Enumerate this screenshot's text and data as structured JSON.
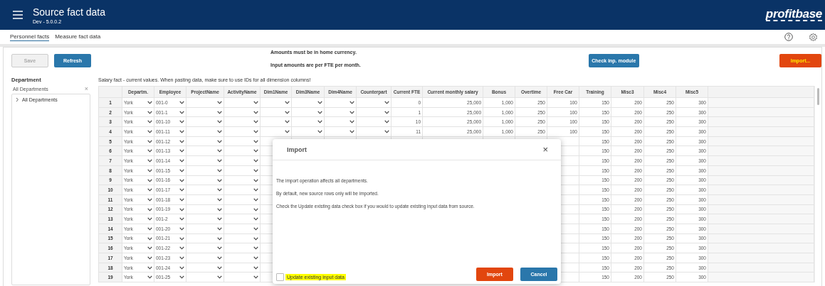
{
  "header": {
    "title": "Source fact data",
    "subtitle": "Dev - 5.0.0.2",
    "logo": "profitbase"
  },
  "tabs": [
    {
      "label": "Personnel facts",
      "selected": true
    },
    {
      "label": "Measure fact data",
      "selected": false
    }
  ],
  "toolbar": {
    "buttons": [
      {
        "label": "Save",
        "kind": "default",
        "disabled": true
      },
      {
        "label": "Refresh",
        "kind": "primary",
        "disabled": false
      }
    ],
    "notes": [
      "Amounts must be in home currency.",
      "Input amounts are per FTE per month."
    ],
    "right_buttons": [
      {
        "label": "Check inp. module",
        "kind": "primary",
        "disabled": false
      },
      {
        "label": "Import...",
        "kind": "accent",
        "disabled": false
      }
    ]
  },
  "sidebar": {
    "label": "Department",
    "filter": {
      "value": "All Departments",
      "clear": "×"
    },
    "tree": [
      {
        "label": "All Departments",
        "expanded": false
      }
    ]
  },
  "table": {
    "caption": "Salary fact - current values. When pasting data, make sure to use IDs for all dimension columns!",
    "columns": [
      {
        "label": "Departm.",
        "kind": "dropdown"
      },
      {
        "label": "Employee",
        "kind": "dropdown"
      },
      {
        "label": "ProjectName",
        "kind": "dropdown"
      },
      {
        "label": "ActivityName",
        "kind": "dropdown"
      },
      {
        "label": "Dim1Name",
        "kind": "dropdown"
      },
      {
        "label": "Dim3Name",
        "kind": "dropdown"
      },
      {
        "label": "Dim4Name",
        "kind": "dropdown"
      },
      {
        "label": "Counterpart",
        "kind": "dropdown"
      },
      {
        "label": "Current FTE",
        "kind": "number"
      },
      {
        "label": "Current monthly salary",
        "kind": "number"
      },
      {
        "label": "Bonus",
        "kind": "number"
      },
      {
        "label": "Overtime",
        "kind": "number"
      },
      {
        "label": "Free Car",
        "kind": "number"
      },
      {
        "label": "Training",
        "kind": "number"
      },
      {
        "label": "Misc3",
        "kind": "number"
      },
      {
        "label": "Misc4",
        "kind": "number"
      },
      {
        "label": "Misc5",
        "kind": "number"
      }
    ],
    "rows": [
      {
        "number": "1",
        "cells": [
          "York",
          "001-0",
          null,
          null,
          null,
          null,
          null,
          null,
          "0",
          "25,000",
          "1,000",
          "250",
          "100",
          "150",
          "200",
          "250",
          "300"
        ]
      },
      {
        "number": "2",
        "cells": [
          "York",
          "001-1",
          null,
          null,
          null,
          null,
          null,
          null,
          "1",
          "25,000",
          "1,000",
          "250",
          "100",
          "150",
          "200",
          "250",
          "300"
        ]
      },
      {
        "number": "3",
        "cells": [
          "York",
          "001-10",
          null,
          null,
          null,
          null,
          null,
          null,
          "10",
          "25,000",
          "1,000",
          "250",
          "100",
          "150",
          "200",
          "250",
          "300"
        ]
      },
      {
        "number": "4",
        "cells": [
          "York",
          "001-11",
          null,
          null,
          null,
          null,
          null,
          null,
          "11",
          "25,000",
          "1,000",
          "250",
          "100",
          "150",
          "200",
          "250",
          "300"
        ]
      },
      {
        "number": "5",
        "cells": [
          "York",
          "001-12",
          null,
          null,
          null,
          null,
          null,
          null,
          null,
          null,
          null,
          null,
          null,
          "150",
          "200",
          "250",
          "300"
        ]
      },
      {
        "number": "6",
        "cells": [
          "York",
          "001-13",
          null,
          null,
          null,
          null,
          null,
          null,
          null,
          null,
          null,
          null,
          null,
          "150",
          "200",
          "250",
          "300"
        ]
      },
      {
        "number": "7",
        "cells": [
          "York",
          "001-14",
          null,
          null,
          null,
          null,
          null,
          null,
          null,
          null,
          null,
          null,
          null,
          "150",
          "200",
          "250",
          "300"
        ]
      },
      {
        "number": "8",
        "cells": [
          "York",
          "001-15",
          null,
          null,
          null,
          null,
          null,
          null,
          null,
          null,
          null,
          null,
          null,
          "150",
          "200",
          "250",
          "300"
        ]
      },
      {
        "number": "9",
        "cells": [
          "York",
          "001-16",
          null,
          null,
          null,
          null,
          null,
          null,
          null,
          null,
          null,
          null,
          null,
          "150",
          "200",
          "250",
          "300"
        ]
      },
      {
        "number": "10",
        "cells": [
          "York",
          "001-17",
          null,
          null,
          null,
          null,
          null,
          null,
          null,
          null,
          null,
          null,
          null,
          "150",
          "200",
          "250",
          "300"
        ]
      },
      {
        "number": "11",
        "cells": [
          "York",
          "001-18",
          null,
          null,
          null,
          null,
          null,
          null,
          null,
          null,
          null,
          null,
          null,
          "150",
          "200",
          "250",
          "300"
        ]
      },
      {
        "number": "12",
        "cells": [
          "York",
          "001-19",
          null,
          null,
          null,
          null,
          null,
          null,
          null,
          null,
          null,
          null,
          null,
          "150",
          "200",
          "250",
          "300"
        ]
      },
      {
        "number": "13",
        "cells": [
          "York",
          "001-2",
          null,
          null,
          null,
          null,
          null,
          null,
          null,
          null,
          null,
          null,
          null,
          "150",
          "200",
          "250",
          "300"
        ]
      },
      {
        "number": "14",
        "cells": [
          "York",
          "001-20",
          null,
          null,
          null,
          null,
          null,
          null,
          null,
          null,
          null,
          null,
          null,
          "150",
          "200",
          "250",
          "300"
        ]
      },
      {
        "number": "15",
        "cells": [
          "York",
          "001-21",
          null,
          null,
          null,
          null,
          null,
          null,
          null,
          null,
          null,
          null,
          null,
          "150",
          "200",
          "250",
          "300"
        ]
      },
      {
        "number": "16",
        "cells": [
          "York",
          "001-22",
          null,
          null,
          null,
          null,
          null,
          null,
          null,
          null,
          null,
          null,
          null,
          "150",
          "200",
          "250",
          "300"
        ]
      },
      {
        "number": "17",
        "cells": [
          "York",
          "001-23",
          null,
          null,
          null,
          null,
          null,
          null,
          null,
          null,
          null,
          null,
          null,
          "150",
          "200",
          "250",
          "300"
        ]
      },
      {
        "number": "18",
        "cells": [
          "York",
          "001-24",
          null,
          null,
          null,
          null,
          null,
          null,
          null,
          null,
          null,
          null,
          null,
          "150",
          "200",
          "250",
          "300"
        ]
      },
      {
        "number": "19",
        "cells": [
          "York",
          "001-25",
          null,
          null,
          null,
          null,
          null,
          null,
          null,
          null,
          null,
          null,
          null,
          "150",
          "200",
          "250",
          "300"
        ]
      }
    ]
  },
  "dialog": {
    "open": true,
    "title": "Import",
    "close": "×",
    "paragraphs": [
      "The import operation affects all departments.",
      "By default, new source rows only will be imported.",
      "Check the Update existing data check box if you would to update existing input data from source."
    ],
    "checkbox": {
      "label": "Update existing input data",
      "checked": false,
      "highlighted": true
    },
    "buttons": [
      {
        "label": "Import",
        "kind": "accent"
      },
      {
        "label": "Cancel",
        "kind": "primary"
      }
    ]
  }
}
